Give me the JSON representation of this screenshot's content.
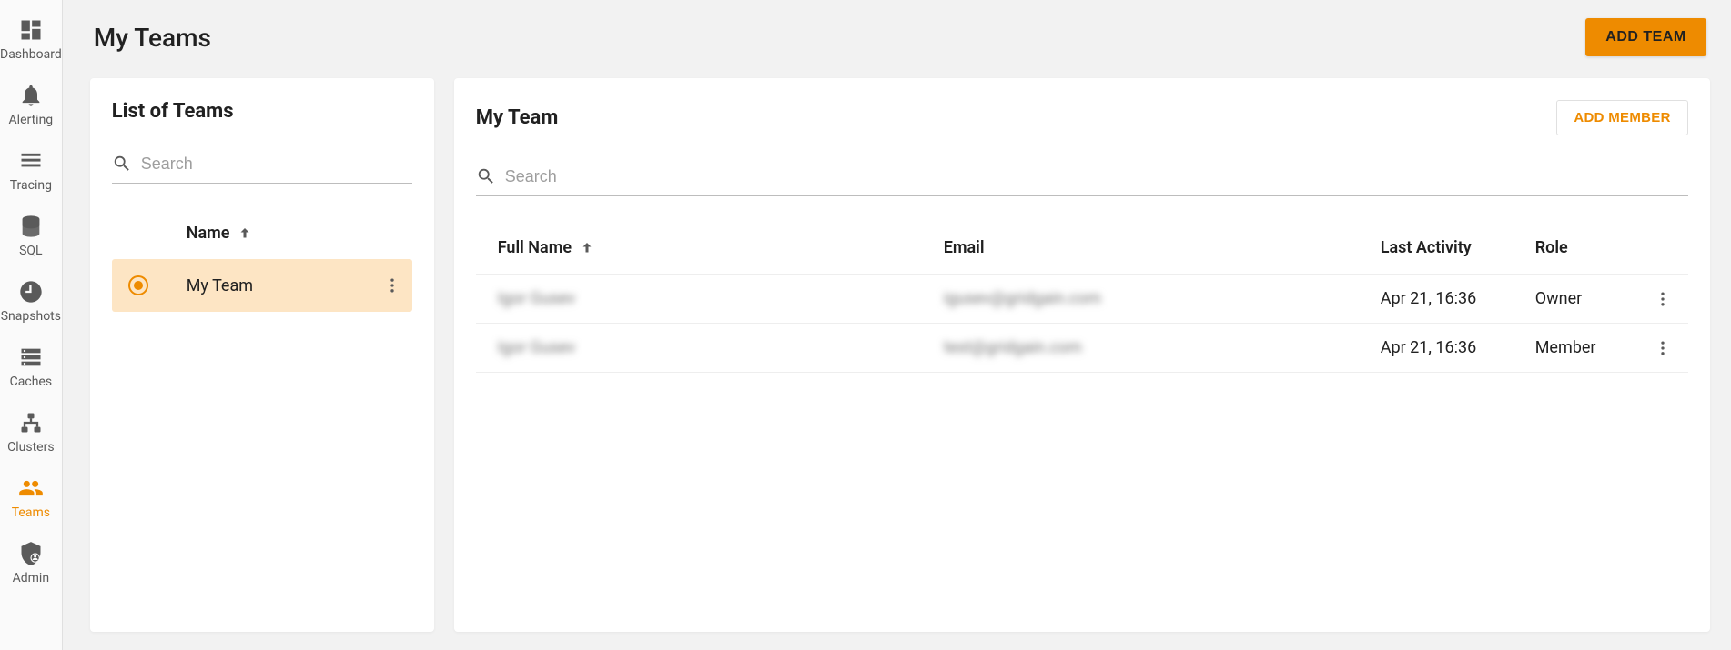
{
  "sidebar": {
    "items": [
      {
        "id": "dashboard",
        "label": "Dashboard",
        "active": false
      },
      {
        "id": "alerting",
        "label": "Alerting",
        "active": false
      },
      {
        "id": "tracing",
        "label": "Tracing",
        "active": false
      },
      {
        "id": "sql",
        "label": "SQL",
        "active": false
      },
      {
        "id": "snapshots",
        "label": "Snapshots",
        "active": false
      },
      {
        "id": "caches",
        "label": "Caches",
        "active": false
      },
      {
        "id": "clusters",
        "label": "Clusters",
        "active": false
      },
      {
        "id": "teams",
        "label": "Teams",
        "active": true
      },
      {
        "id": "admin",
        "label": "Admin",
        "active": false
      }
    ]
  },
  "header": {
    "title": "My Teams",
    "add_team_label": "ADD TEAM"
  },
  "teams_panel": {
    "title": "List of Teams",
    "search_placeholder": "Search",
    "column_name": "Name",
    "teams": [
      {
        "name": "My Team",
        "selected": true
      }
    ]
  },
  "members_panel": {
    "title": "My Team",
    "add_member_label": "ADD MEMBER",
    "search_placeholder": "Search",
    "columns": {
      "full_name": "Full Name",
      "email": "Email",
      "last_activity": "Last Activity",
      "role": "Role"
    },
    "members": [
      {
        "full_name": "Igor Gusev",
        "email": "igusev@gridgain.com",
        "last_activity": "Apr 21, 16:36",
        "role": "Owner"
      },
      {
        "full_name": "Igor Gusev",
        "email": "test@gridgain.com",
        "last_activity": "Apr 21, 16:36",
        "role": "Member"
      }
    ]
  }
}
